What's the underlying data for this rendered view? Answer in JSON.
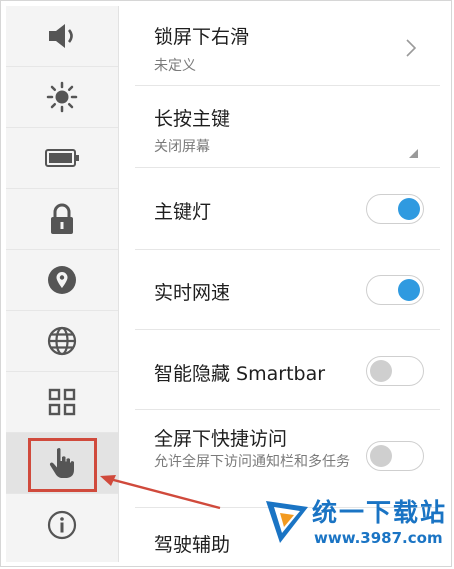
{
  "sidebar": {
    "items": [
      {
        "icon": "volume-icon"
      },
      {
        "icon": "brightness-icon"
      },
      {
        "icon": "battery-icon"
      },
      {
        "icon": "lock-icon"
      },
      {
        "icon": "location-icon"
      },
      {
        "icon": "globe-icon"
      },
      {
        "icon": "grid-icon"
      },
      {
        "icon": "hand-pointer-icon",
        "selected": true
      },
      {
        "icon": "info-icon"
      }
    ]
  },
  "settings": [
    {
      "title": "锁屏下右滑",
      "subtitle": "未定义",
      "control": "chevron"
    },
    {
      "title": "长按主键",
      "subtitle": "关闭屏幕",
      "control": "dropdown"
    },
    {
      "title": "主键灯",
      "control": "toggle",
      "state": true
    },
    {
      "title": "实时网速",
      "control": "toggle",
      "state": true
    },
    {
      "title": "智能隐藏 Smartbar",
      "control": "toggle",
      "state": false
    },
    {
      "title": "全屏下快捷访问",
      "subtitle": "允许全屏下访问通知栏和多任务",
      "control": "toggle",
      "state": false
    },
    {
      "title": "驾驶辅助"
    }
  ],
  "watermark": {
    "name": "统一下载站",
    "url": "www.3987.com"
  },
  "colors": {
    "accent": "#2f9ae0",
    "highlight": "#d04a3c",
    "watermark": "#1a74c4"
  }
}
